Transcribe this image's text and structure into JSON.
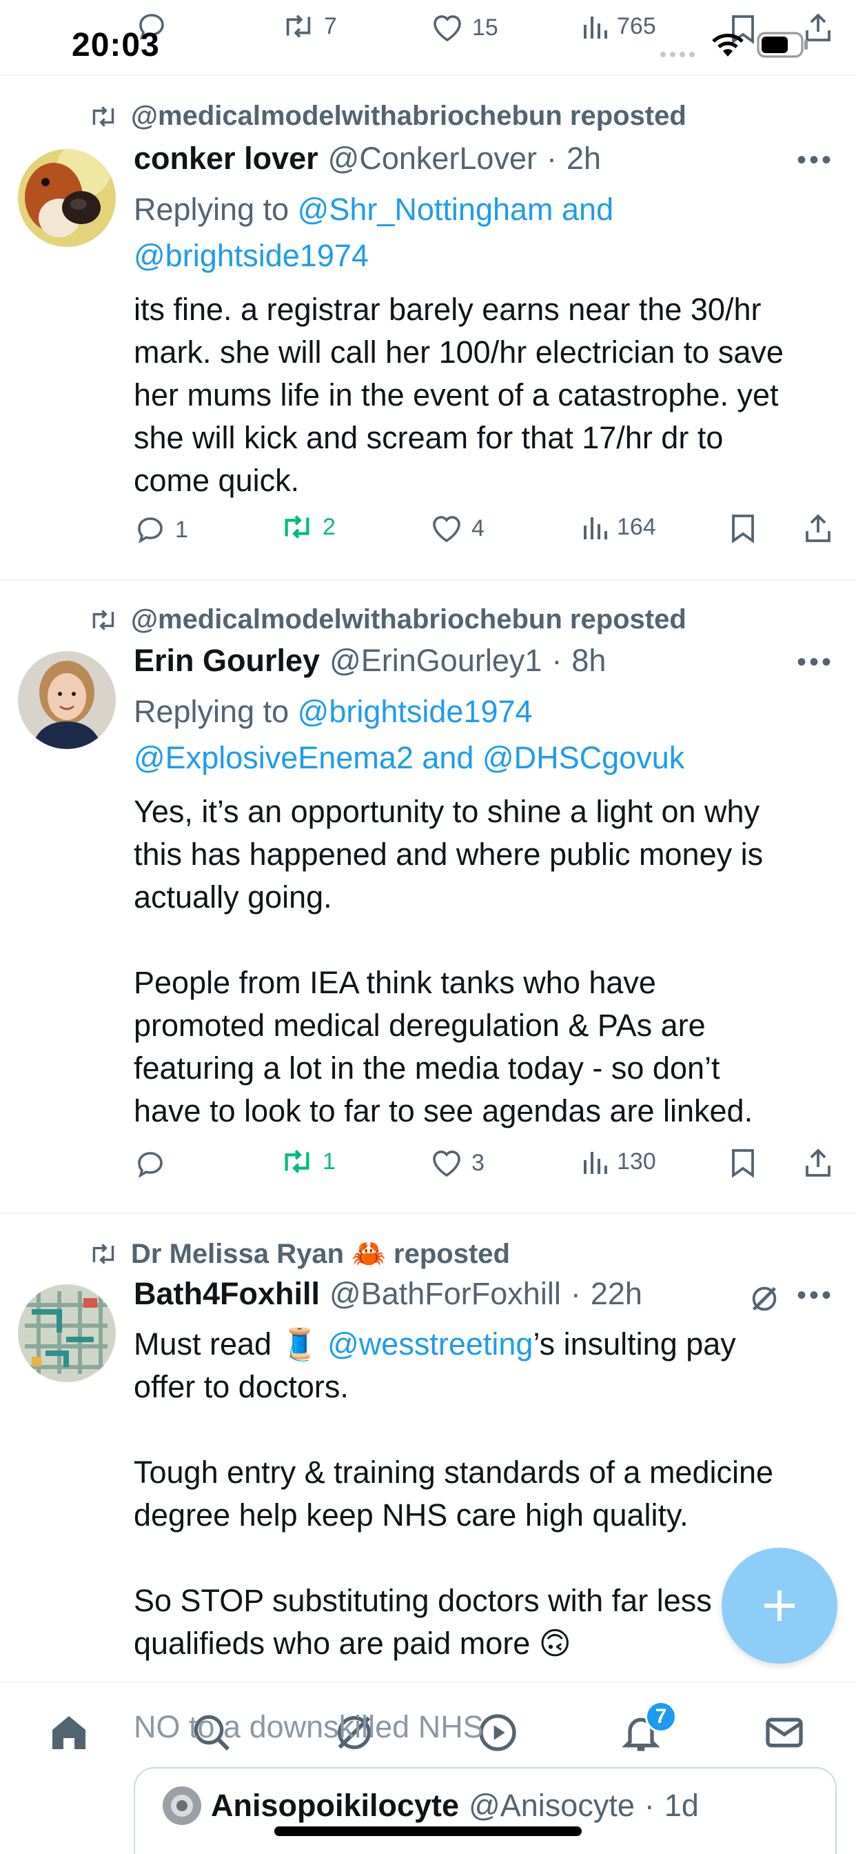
{
  "status_bar": {
    "time": "20:03"
  },
  "prev_post_actions": {
    "replies": "",
    "reposts": "7",
    "likes": "15",
    "views": "765"
  },
  "posts": [
    {
      "repost_label": "@medicalmodelwithabriochebun reposted",
      "name": "conker lover",
      "handle": "@ConkerLover",
      "time": "2h",
      "reply_prefix": "Replying to",
      "reply_line1": "@Shr_Nottingham and",
      "reply_line2": "@brightside1974",
      "text": "its fine. a registrar barely earns near the 30/hr\nmark. she will call her 100/hr electrician to save\nher mums life in the event of a catastrophe. yet\nshe will kick and scream for that 17/hr dr to\ncome quick.",
      "replies": "1",
      "reposts": "2",
      "likes": "4",
      "views": "164"
    },
    {
      "repost_label": "@medicalmodelwithabriochebun reposted",
      "name": "Erin Gourley",
      "handle": "@ErinGourley1",
      "time": "8h",
      "reply_prefix": "Replying to",
      "reply_line1": "@brightside1974",
      "reply_line2": "@ExplosiveEnema2 and @DHSCgovuk",
      "text": "Yes, it’s an opportunity to shine a light on why\nthis has happened and where public money is\nactually going.\n\nPeople from IEA think tanks who have\npromoted medical deregulation & PAs are\nfeaturing a lot in the media today - so don’t\nhave to look to far to see agendas are linked.",
      "replies": "",
      "reposts": "1",
      "likes": "3",
      "views": "130"
    },
    {
      "repost_label": "Dr Melissa Ryan 🦀 reposted",
      "name": "Bath4Foxhill",
      "handle": "@BathForFoxhill",
      "time": "22h",
      "text_before_mention": "Must read 🧵 ",
      "mention": "@wesstreeting",
      "text_after_mention": "’s insulting pay\noffer to doctors.\n\nTough entry & training standards of a medicine\ndegree help keep NHS care high quality.\n\nSo STOP substituting doctors with far less\nqualifieds who are paid more 🙃",
      "peek_text": "NO to a downskilled NHS"
    }
  ],
  "quoted": {
    "name": "Anisopoikilocyte",
    "handle": "@Anisocyte",
    "time": "1d"
  },
  "notifications_badge": "7",
  "colors": {
    "accent": "#1d9bf0",
    "repost_green": "#00ba7c",
    "fab": "#8ecdf8",
    "text_gray": "#536471"
  }
}
